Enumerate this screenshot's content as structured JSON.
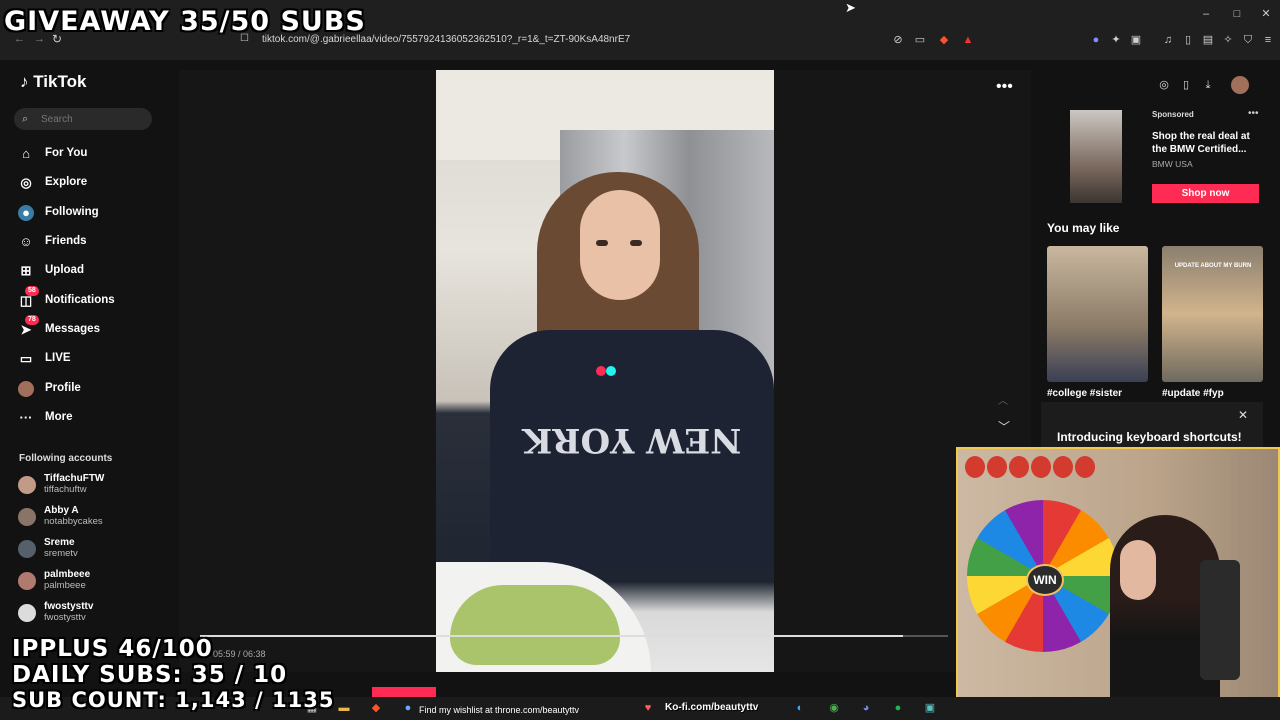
{
  "browser": {
    "url": "tiktok.com/@.gabrieellaa/video/7557924136052362510?_r=1&_t=ZT-90KsA48nrE7",
    "window_controls": [
      "–",
      "□",
      "✕"
    ]
  },
  "stream_overlay": {
    "giveaway": "GIVEAWAY 35/50 SUBS",
    "ipplus": "IPPLUS 46/100",
    "daily_subs": "DAILY SUBS: 35 / 10",
    "sub_count": "SUB COUNT: 1,143 / 1135"
  },
  "sidebar": {
    "logo": "TikTok",
    "search_placeholder": "Search",
    "nav": [
      {
        "label": "For You",
        "icon": "home-icon"
      },
      {
        "label": "Explore",
        "icon": "compass-icon"
      },
      {
        "label": "Following",
        "icon": "following-icon"
      },
      {
        "label": "Friends",
        "icon": "friends-icon"
      },
      {
        "label": "Upload",
        "icon": "upload-icon"
      },
      {
        "label": "Notifications",
        "icon": "bell-icon",
        "badge": "58"
      },
      {
        "label": "Messages",
        "icon": "send-icon",
        "badge": "78"
      },
      {
        "label": "LIVE",
        "icon": "live-icon"
      },
      {
        "label": "Profile",
        "icon": "avatar"
      },
      {
        "label": "More",
        "icon": "more-icon"
      }
    ],
    "following_header": "Following accounts",
    "accounts": [
      {
        "name": "TiffachuFTW",
        "handle": "tiffachuftw"
      },
      {
        "name": "Abby A",
        "handle": "notabbycakes"
      },
      {
        "name": "Sreme",
        "handle": "sremetv"
      },
      {
        "name": "palmbeee",
        "handle": "palmbeee"
      },
      {
        "name": "fwostysttv",
        "handle": "fwostysttv"
      }
    ]
  },
  "video": {
    "time": "05:59 / 06:38",
    "progress": 0.94,
    "sweater_text": "NEW YORK"
  },
  "right_panel": {
    "sponsored": "Sponsored",
    "ad_title": "Shop the real deal at the BMW Certified...",
    "ad_brand": "BMW USA",
    "shop_now": "Shop now",
    "you_may_like": "You may like",
    "rec1_caption": "#college #sister",
    "rec2_caption": "#update #fyp",
    "rec2_overlay": "UPDATE ABOUT MY BURN",
    "keyboard_banner": "Introducing keyboard shortcuts!"
  },
  "webcam": {
    "wheel_label": "WIN"
  },
  "taskbar": {
    "throne": "Find my wishlist at throne.com/beautyttv",
    "kofi": "Ko-fi.com/beautyttv"
  }
}
